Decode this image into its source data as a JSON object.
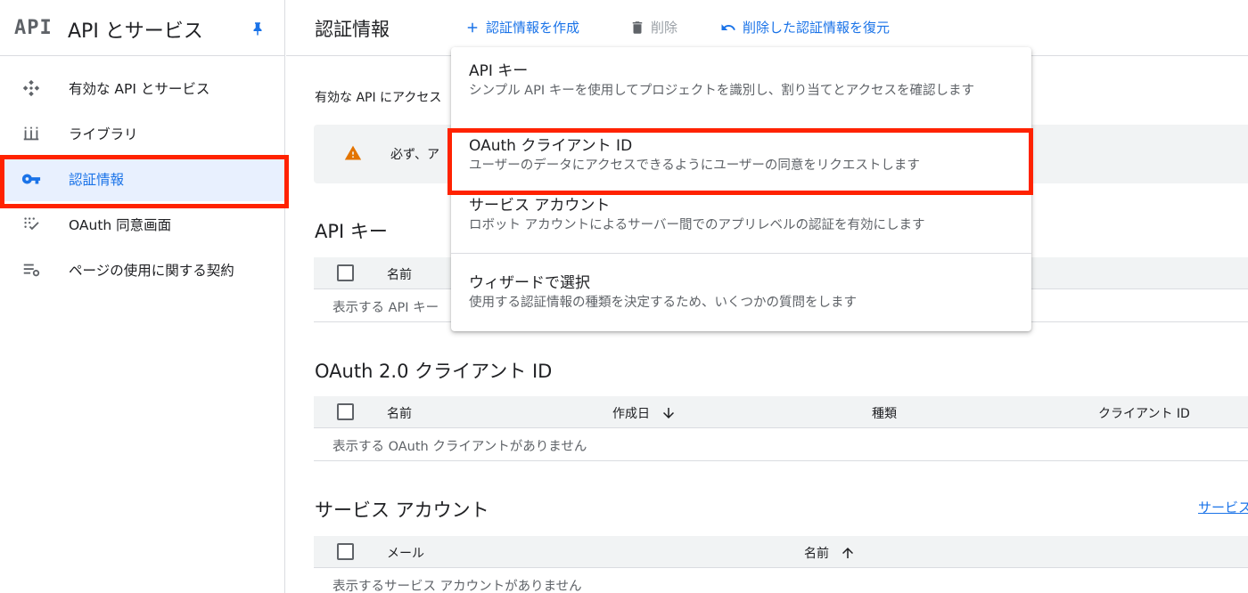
{
  "sidebar": {
    "logo": "API",
    "title": "API とサービス",
    "items": [
      {
        "label": "有効な API とサービス"
      },
      {
        "label": "ライブラリ"
      },
      {
        "label": "認証情報"
      },
      {
        "label": "OAuth 同意画面"
      },
      {
        "label": "ページの使用に関する契約"
      }
    ]
  },
  "topbar": {
    "title": "認証情報",
    "create_label": "認証情報を作成",
    "delete_label": "削除",
    "restore_label": "削除した認証情報を復元"
  },
  "main": {
    "intro": "有効な API にアクセス",
    "warning": "必ず、ア"
  },
  "api_keys": {
    "title": "API キー",
    "col_name": "名前",
    "empty": "表示する API キー"
  },
  "oauth": {
    "title": "OAuth 2.0 クライアント ID",
    "col_name": "名前",
    "col_created": "作成日",
    "col_type": "種類",
    "col_client_id": "クライアント ID",
    "empty": "表示する OAuth クライアントがありません"
  },
  "service_accounts": {
    "title": "サービス アカウント",
    "link": "サービス",
    "col_email": "メール",
    "col_name": "名前",
    "empty": "表示するサービス アカウントがありません"
  },
  "menu": {
    "items": [
      {
        "title": "API キー",
        "desc": "シンプル API キーを使用してプロジェクトを識別し、割り当てとアクセスを確認します"
      },
      {
        "title": "OAuth クライアント ID",
        "desc": "ユーザーのデータにアクセスできるようにユーザーの同意をリクエストします"
      },
      {
        "title": "サービス アカウント",
        "desc": "ロボット アカウントによるサーバー間でのアプリレベルの認証を有効にします"
      },
      {
        "title": "ウィザードで選択",
        "desc": "使用する認証情報の種類を決定するため、いくつかの質問をします"
      }
    ]
  },
  "colors": {
    "accent": "#1a73e8",
    "highlight": "#ff2200",
    "warning": "#e37400"
  }
}
